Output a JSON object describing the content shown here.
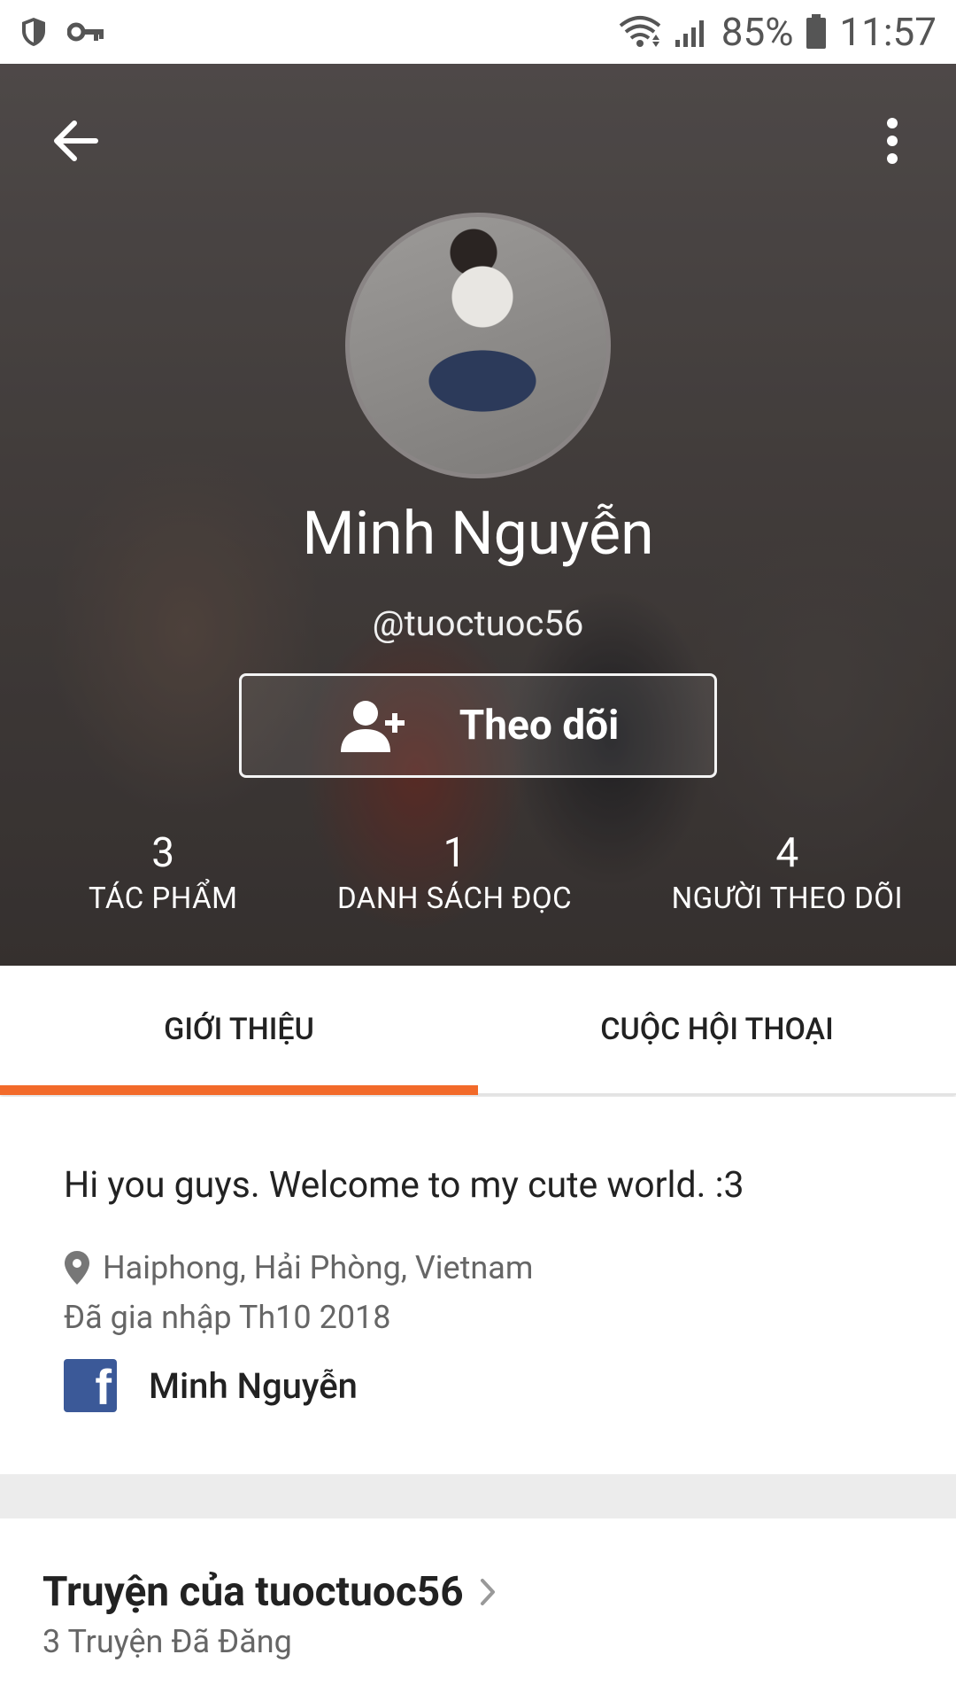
{
  "status_bar": {
    "battery": "85%",
    "time": "11:57"
  },
  "profile": {
    "name": "Minh Nguyễn",
    "handle": "@tuoctuoc56",
    "follow_label": "Theo dõi"
  },
  "stats": [
    {
      "value": "3",
      "label": "TÁC PHẨM"
    },
    {
      "value": "1",
      "label": "DANH SÁCH ĐỌC"
    },
    {
      "value": "4",
      "label": "NGƯỜI THEO DÕI"
    }
  ],
  "tabs": [
    {
      "label": "GIỚI THIỆU",
      "active": true
    },
    {
      "label": "CUỘC HỘI THOẠI",
      "active": false
    }
  ],
  "about": {
    "bio": "Hi you guys. Welcome to my cute world. :3",
    "location": "Haiphong, Hải Phòng, Vietnam",
    "joined": "Đã gia nhập Th10 2018",
    "facebook_name": "Minh Nguyễn",
    "facebook_icon_letter": "f"
  },
  "stories": {
    "title": "Truyện của tuoctuoc56",
    "subtitle": "3 Truyện Đã Đăng"
  },
  "colors": {
    "accent": "#f26a2a",
    "facebook": "#3b5998"
  }
}
